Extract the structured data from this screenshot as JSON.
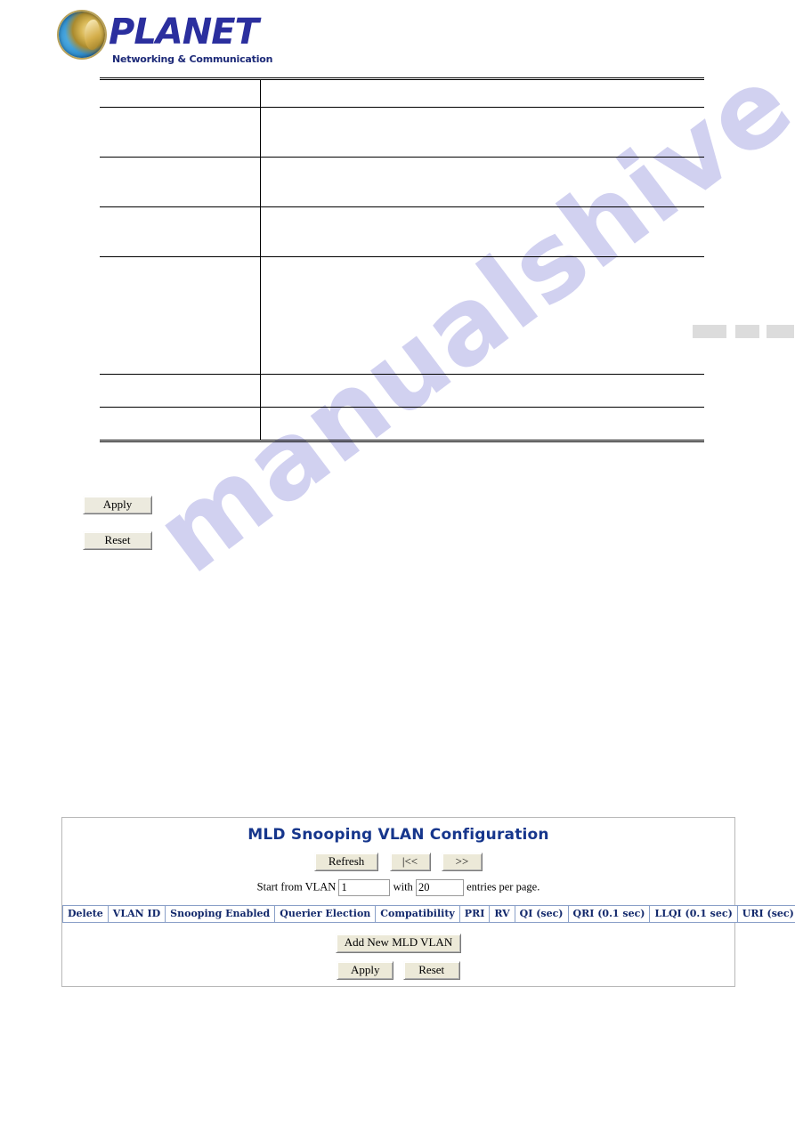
{
  "brand": {
    "name": "PLANET",
    "tagline": "Networking & Communication",
    "logo_icon": "planet-globe-icon",
    "word_color": "#2b2f9e",
    "tagline_color": "#1d2a78"
  },
  "watermark": {
    "text": "manualshive.com",
    "color": "#c9c9ee"
  },
  "spec_table": {
    "rows": [
      {
        "term": "",
        "description": ""
      },
      {
        "term": "",
        "description": ""
      },
      {
        "term": "",
        "description": ""
      },
      {
        "term": "",
        "description": ""
      },
      {
        "term": "",
        "description": ""
      },
      {
        "term": "",
        "description": ""
      },
      {
        "term": "",
        "description": ""
      }
    ]
  },
  "standalone_buttons": {
    "apply_label": "Apply",
    "reset_label": "Reset"
  },
  "mld_panel": {
    "title": "MLD Snooping VLAN Configuration",
    "title_color": "#16368c",
    "nav": {
      "refresh_label": "Refresh",
      "first_label": "|<<",
      "next_label": ">>"
    },
    "range": {
      "prefix_label": "Start from VLAN",
      "vlan_value": "1",
      "middle_label": "with",
      "entries_value": "20",
      "suffix_label": "entries per page."
    },
    "table": {
      "headers": [
        "Delete",
        "VLAN ID",
        "Snooping Enabled",
        "Querier Election",
        "Compatibility",
        "PRI",
        "RV",
        "QI (sec)",
        "QRI (0.1 sec)",
        "LLQI (0.1 sec)",
        "URI (sec)"
      ],
      "rows": []
    },
    "add_button_label": "Add New MLD VLAN",
    "apply_label": "Apply",
    "reset_label": "Reset"
  }
}
